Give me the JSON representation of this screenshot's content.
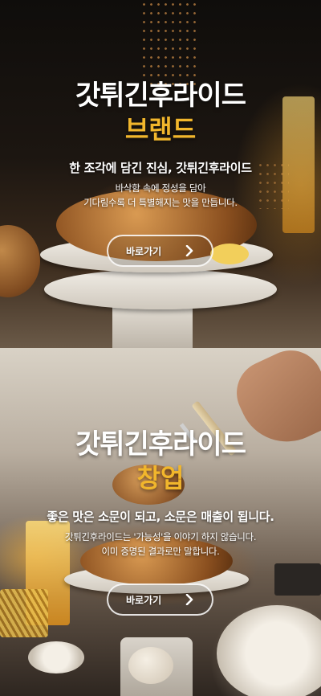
{
  "sections": [
    {
      "title": "갓튀긴후라이드",
      "subtitle": "브랜드",
      "headline": "한 조각에 담긴 진심, 갓튀긴후라이드",
      "desc_line1": "바삭함 속에 정성을 담아",
      "desc_line2": "기다림수록 더 특별해지는 맛을 만듭니다.",
      "button_label": "바로가기",
      "button_icon": "chevron-right-icon"
    },
    {
      "title": "갓튀긴후라이드",
      "subtitle": "창업",
      "headline": "좋은 맛은 소문이 되고, 소문은 매출이 됩니다.",
      "desc_line1": "갓튀긴후라이드는 '가능성'을 이야기 하지 않습니다.",
      "desc_line2": "이미 증명된 결과로만 말합니다.",
      "button_label": "바로가기",
      "button_icon": "chevron-right-icon"
    }
  ],
  "colors": {
    "accent_gold": "#f1b62c",
    "text_white": "#ffffff"
  }
}
